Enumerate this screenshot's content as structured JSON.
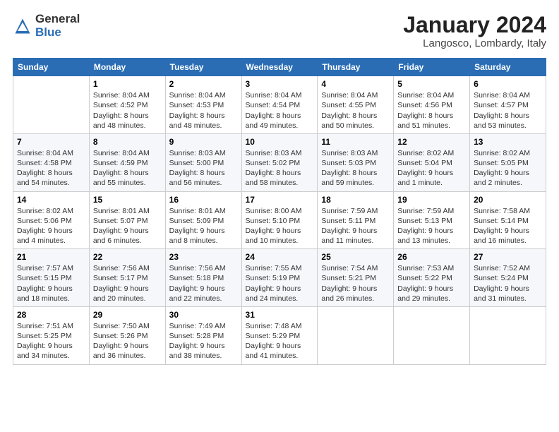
{
  "logo": {
    "general": "General",
    "blue": "Blue"
  },
  "header": {
    "month": "January 2024",
    "location": "Langosco, Lombardy, Italy"
  },
  "weekdays": [
    "Sunday",
    "Monday",
    "Tuesday",
    "Wednesday",
    "Thursday",
    "Friday",
    "Saturday"
  ],
  "weeks": [
    [
      {
        "day": "",
        "info": ""
      },
      {
        "day": "1",
        "info": "Sunrise: 8:04 AM\nSunset: 4:52 PM\nDaylight: 8 hours\nand 48 minutes."
      },
      {
        "day": "2",
        "info": "Sunrise: 8:04 AM\nSunset: 4:53 PM\nDaylight: 8 hours\nand 48 minutes."
      },
      {
        "day": "3",
        "info": "Sunrise: 8:04 AM\nSunset: 4:54 PM\nDaylight: 8 hours\nand 49 minutes."
      },
      {
        "day": "4",
        "info": "Sunrise: 8:04 AM\nSunset: 4:55 PM\nDaylight: 8 hours\nand 50 minutes."
      },
      {
        "day": "5",
        "info": "Sunrise: 8:04 AM\nSunset: 4:56 PM\nDaylight: 8 hours\nand 51 minutes."
      },
      {
        "day": "6",
        "info": "Sunrise: 8:04 AM\nSunset: 4:57 PM\nDaylight: 8 hours\nand 53 minutes."
      }
    ],
    [
      {
        "day": "7",
        "info": "Sunrise: 8:04 AM\nSunset: 4:58 PM\nDaylight: 8 hours\nand 54 minutes."
      },
      {
        "day": "8",
        "info": "Sunrise: 8:04 AM\nSunset: 4:59 PM\nDaylight: 8 hours\nand 55 minutes."
      },
      {
        "day": "9",
        "info": "Sunrise: 8:03 AM\nSunset: 5:00 PM\nDaylight: 8 hours\nand 56 minutes."
      },
      {
        "day": "10",
        "info": "Sunrise: 8:03 AM\nSunset: 5:02 PM\nDaylight: 8 hours\nand 58 minutes."
      },
      {
        "day": "11",
        "info": "Sunrise: 8:03 AM\nSunset: 5:03 PM\nDaylight: 8 hours\nand 59 minutes."
      },
      {
        "day": "12",
        "info": "Sunrise: 8:02 AM\nSunset: 5:04 PM\nDaylight: 9 hours\nand 1 minute."
      },
      {
        "day": "13",
        "info": "Sunrise: 8:02 AM\nSunset: 5:05 PM\nDaylight: 9 hours\nand 2 minutes."
      }
    ],
    [
      {
        "day": "14",
        "info": "Sunrise: 8:02 AM\nSunset: 5:06 PM\nDaylight: 9 hours\nand 4 minutes."
      },
      {
        "day": "15",
        "info": "Sunrise: 8:01 AM\nSunset: 5:07 PM\nDaylight: 9 hours\nand 6 minutes."
      },
      {
        "day": "16",
        "info": "Sunrise: 8:01 AM\nSunset: 5:09 PM\nDaylight: 9 hours\nand 8 minutes."
      },
      {
        "day": "17",
        "info": "Sunrise: 8:00 AM\nSunset: 5:10 PM\nDaylight: 9 hours\nand 10 minutes."
      },
      {
        "day": "18",
        "info": "Sunrise: 7:59 AM\nSunset: 5:11 PM\nDaylight: 9 hours\nand 11 minutes."
      },
      {
        "day": "19",
        "info": "Sunrise: 7:59 AM\nSunset: 5:13 PM\nDaylight: 9 hours\nand 13 minutes."
      },
      {
        "day": "20",
        "info": "Sunrise: 7:58 AM\nSunset: 5:14 PM\nDaylight: 9 hours\nand 16 minutes."
      }
    ],
    [
      {
        "day": "21",
        "info": "Sunrise: 7:57 AM\nSunset: 5:15 PM\nDaylight: 9 hours\nand 18 minutes."
      },
      {
        "day": "22",
        "info": "Sunrise: 7:56 AM\nSunset: 5:17 PM\nDaylight: 9 hours\nand 20 minutes."
      },
      {
        "day": "23",
        "info": "Sunrise: 7:56 AM\nSunset: 5:18 PM\nDaylight: 9 hours\nand 22 minutes."
      },
      {
        "day": "24",
        "info": "Sunrise: 7:55 AM\nSunset: 5:19 PM\nDaylight: 9 hours\nand 24 minutes."
      },
      {
        "day": "25",
        "info": "Sunrise: 7:54 AM\nSunset: 5:21 PM\nDaylight: 9 hours\nand 26 minutes."
      },
      {
        "day": "26",
        "info": "Sunrise: 7:53 AM\nSunset: 5:22 PM\nDaylight: 9 hours\nand 29 minutes."
      },
      {
        "day": "27",
        "info": "Sunrise: 7:52 AM\nSunset: 5:24 PM\nDaylight: 9 hours\nand 31 minutes."
      }
    ],
    [
      {
        "day": "28",
        "info": "Sunrise: 7:51 AM\nSunset: 5:25 PM\nDaylight: 9 hours\nand 34 minutes."
      },
      {
        "day": "29",
        "info": "Sunrise: 7:50 AM\nSunset: 5:26 PM\nDaylight: 9 hours\nand 36 minutes."
      },
      {
        "day": "30",
        "info": "Sunrise: 7:49 AM\nSunset: 5:28 PM\nDaylight: 9 hours\nand 38 minutes."
      },
      {
        "day": "31",
        "info": "Sunrise: 7:48 AM\nSunset: 5:29 PM\nDaylight: 9 hours\nand 41 minutes."
      },
      {
        "day": "",
        "info": ""
      },
      {
        "day": "",
        "info": ""
      },
      {
        "day": "",
        "info": ""
      }
    ]
  ]
}
